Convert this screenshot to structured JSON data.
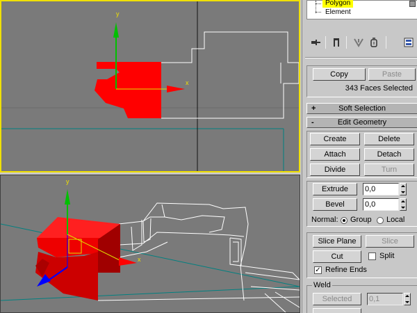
{
  "viewport_top": {
    "gizmo_y": "y",
    "gizmo_x": "x"
  },
  "viewport_persp": {
    "gizmo_y": "y",
    "gizmo_x": "x"
  },
  "selection_tree": {
    "items": [
      "Polygon",
      "Element"
    ]
  },
  "toolbar_icons": [
    "pin-stack-icon",
    "show-end-result-icon",
    "make-unique-icon",
    "remove-modifier-icon",
    "configure-modifier-sets-icon"
  ],
  "clipboard": {
    "copy": "Copy",
    "paste": "Paste",
    "status": "343 Faces Selected"
  },
  "soft_selection": {
    "sign": "+",
    "title": "Soft Selection"
  },
  "edit_geometry": {
    "sign": "-",
    "title": "Edit Geometry",
    "create": "Create",
    "delete": "Delete",
    "attach": "Attach",
    "detach": "Detach",
    "divide": "Divide",
    "turn": "Turn",
    "extrude": "Extrude",
    "extrude_value": "0,0",
    "bevel": "Bevel",
    "bevel_value": "0,0",
    "normal_label": "Normal:",
    "group": "Group",
    "local": "Local",
    "normal_selected": "Group",
    "slice_plane": "Slice Plane",
    "slice": "Slice",
    "cut": "Cut",
    "split": "Split",
    "split_checked": false,
    "refine_ends": "Refine Ends",
    "refine_checked": true,
    "weld_group": "Weld",
    "weld_selected": "Selected",
    "weld_value": "0,1"
  },
  "colors": {
    "active_viewport_border": "#f0e000",
    "selection": "#ff0000",
    "gizmo_y": "#00c000",
    "gizmo_z": "#0000ff",
    "gizmo_x": "#ff0000",
    "wireframe": "#ffffff",
    "grid": "#008080"
  }
}
